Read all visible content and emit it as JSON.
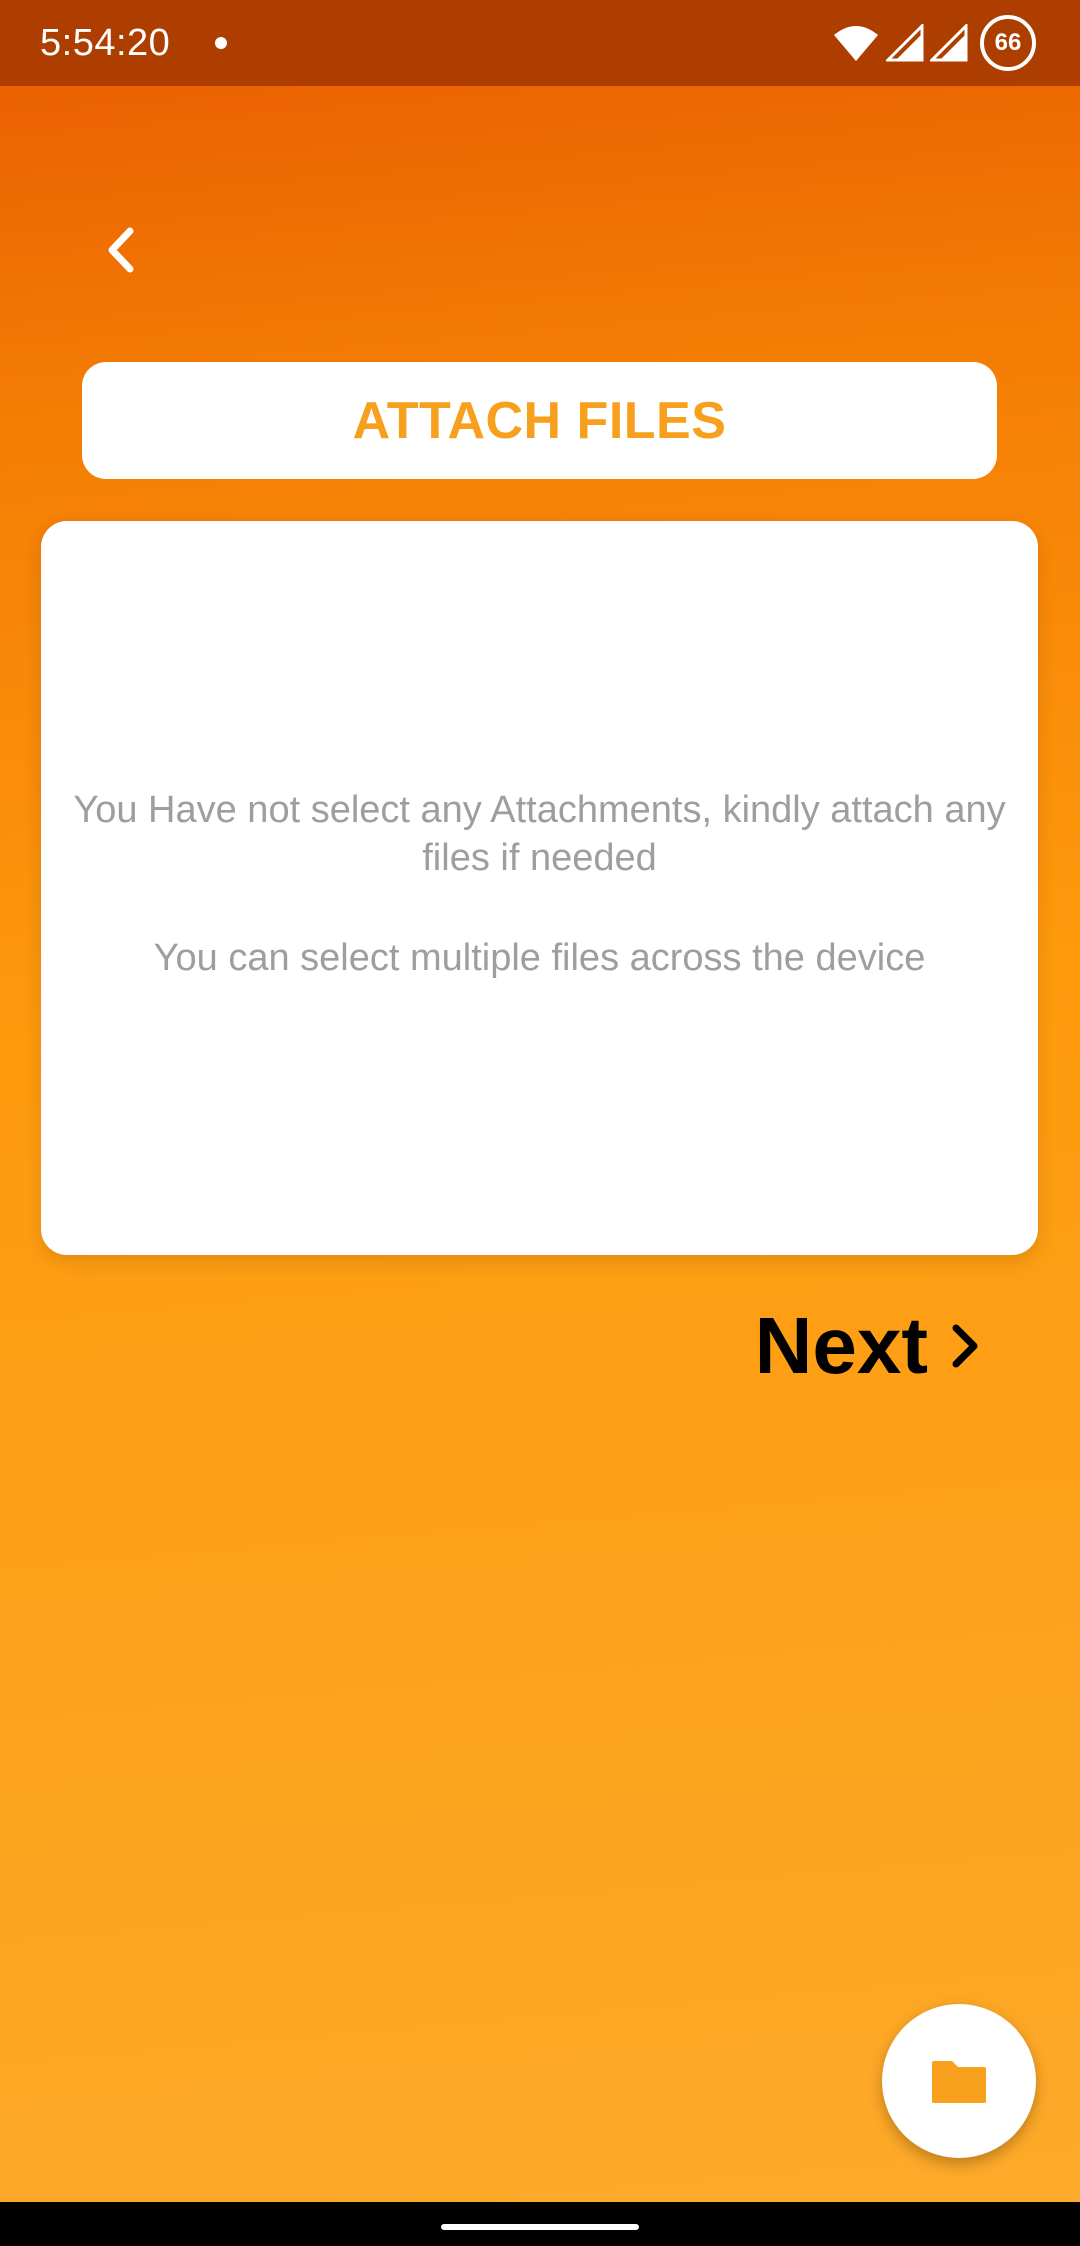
{
  "status_bar": {
    "time": "5:54:20",
    "battery_level": "66",
    "icons": [
      "notification-dot-icon",
      "wifi-icon",
      "signal-icon",
      "signal-icon",
      "battery-ring-icon"
    ]
  },
  "header": {
    "back_icon": "chevron-left-icon"
  },
  "attach": {
    "title": "ATTACH FILES",
    "accent_color": "#f6a01e"
  },
  "card": {
    "empty_message": "You Have not select any Attachments, kindly attach any files if needed",
    "hint": "You can select multiple files across the device"
  },
  "next": {
    "label": "Next",
    "icon": "chevron-right-icon"
  },
  "fab": {
    "icon": "folder-icon",
    "color": "#f6a01e"
  },
  "colors": {
    "gradient_top": "#e85a00",
    "gradient_bottom": "#fdaa2b",
    "status_bar": "#ad3e00"
  }
}
